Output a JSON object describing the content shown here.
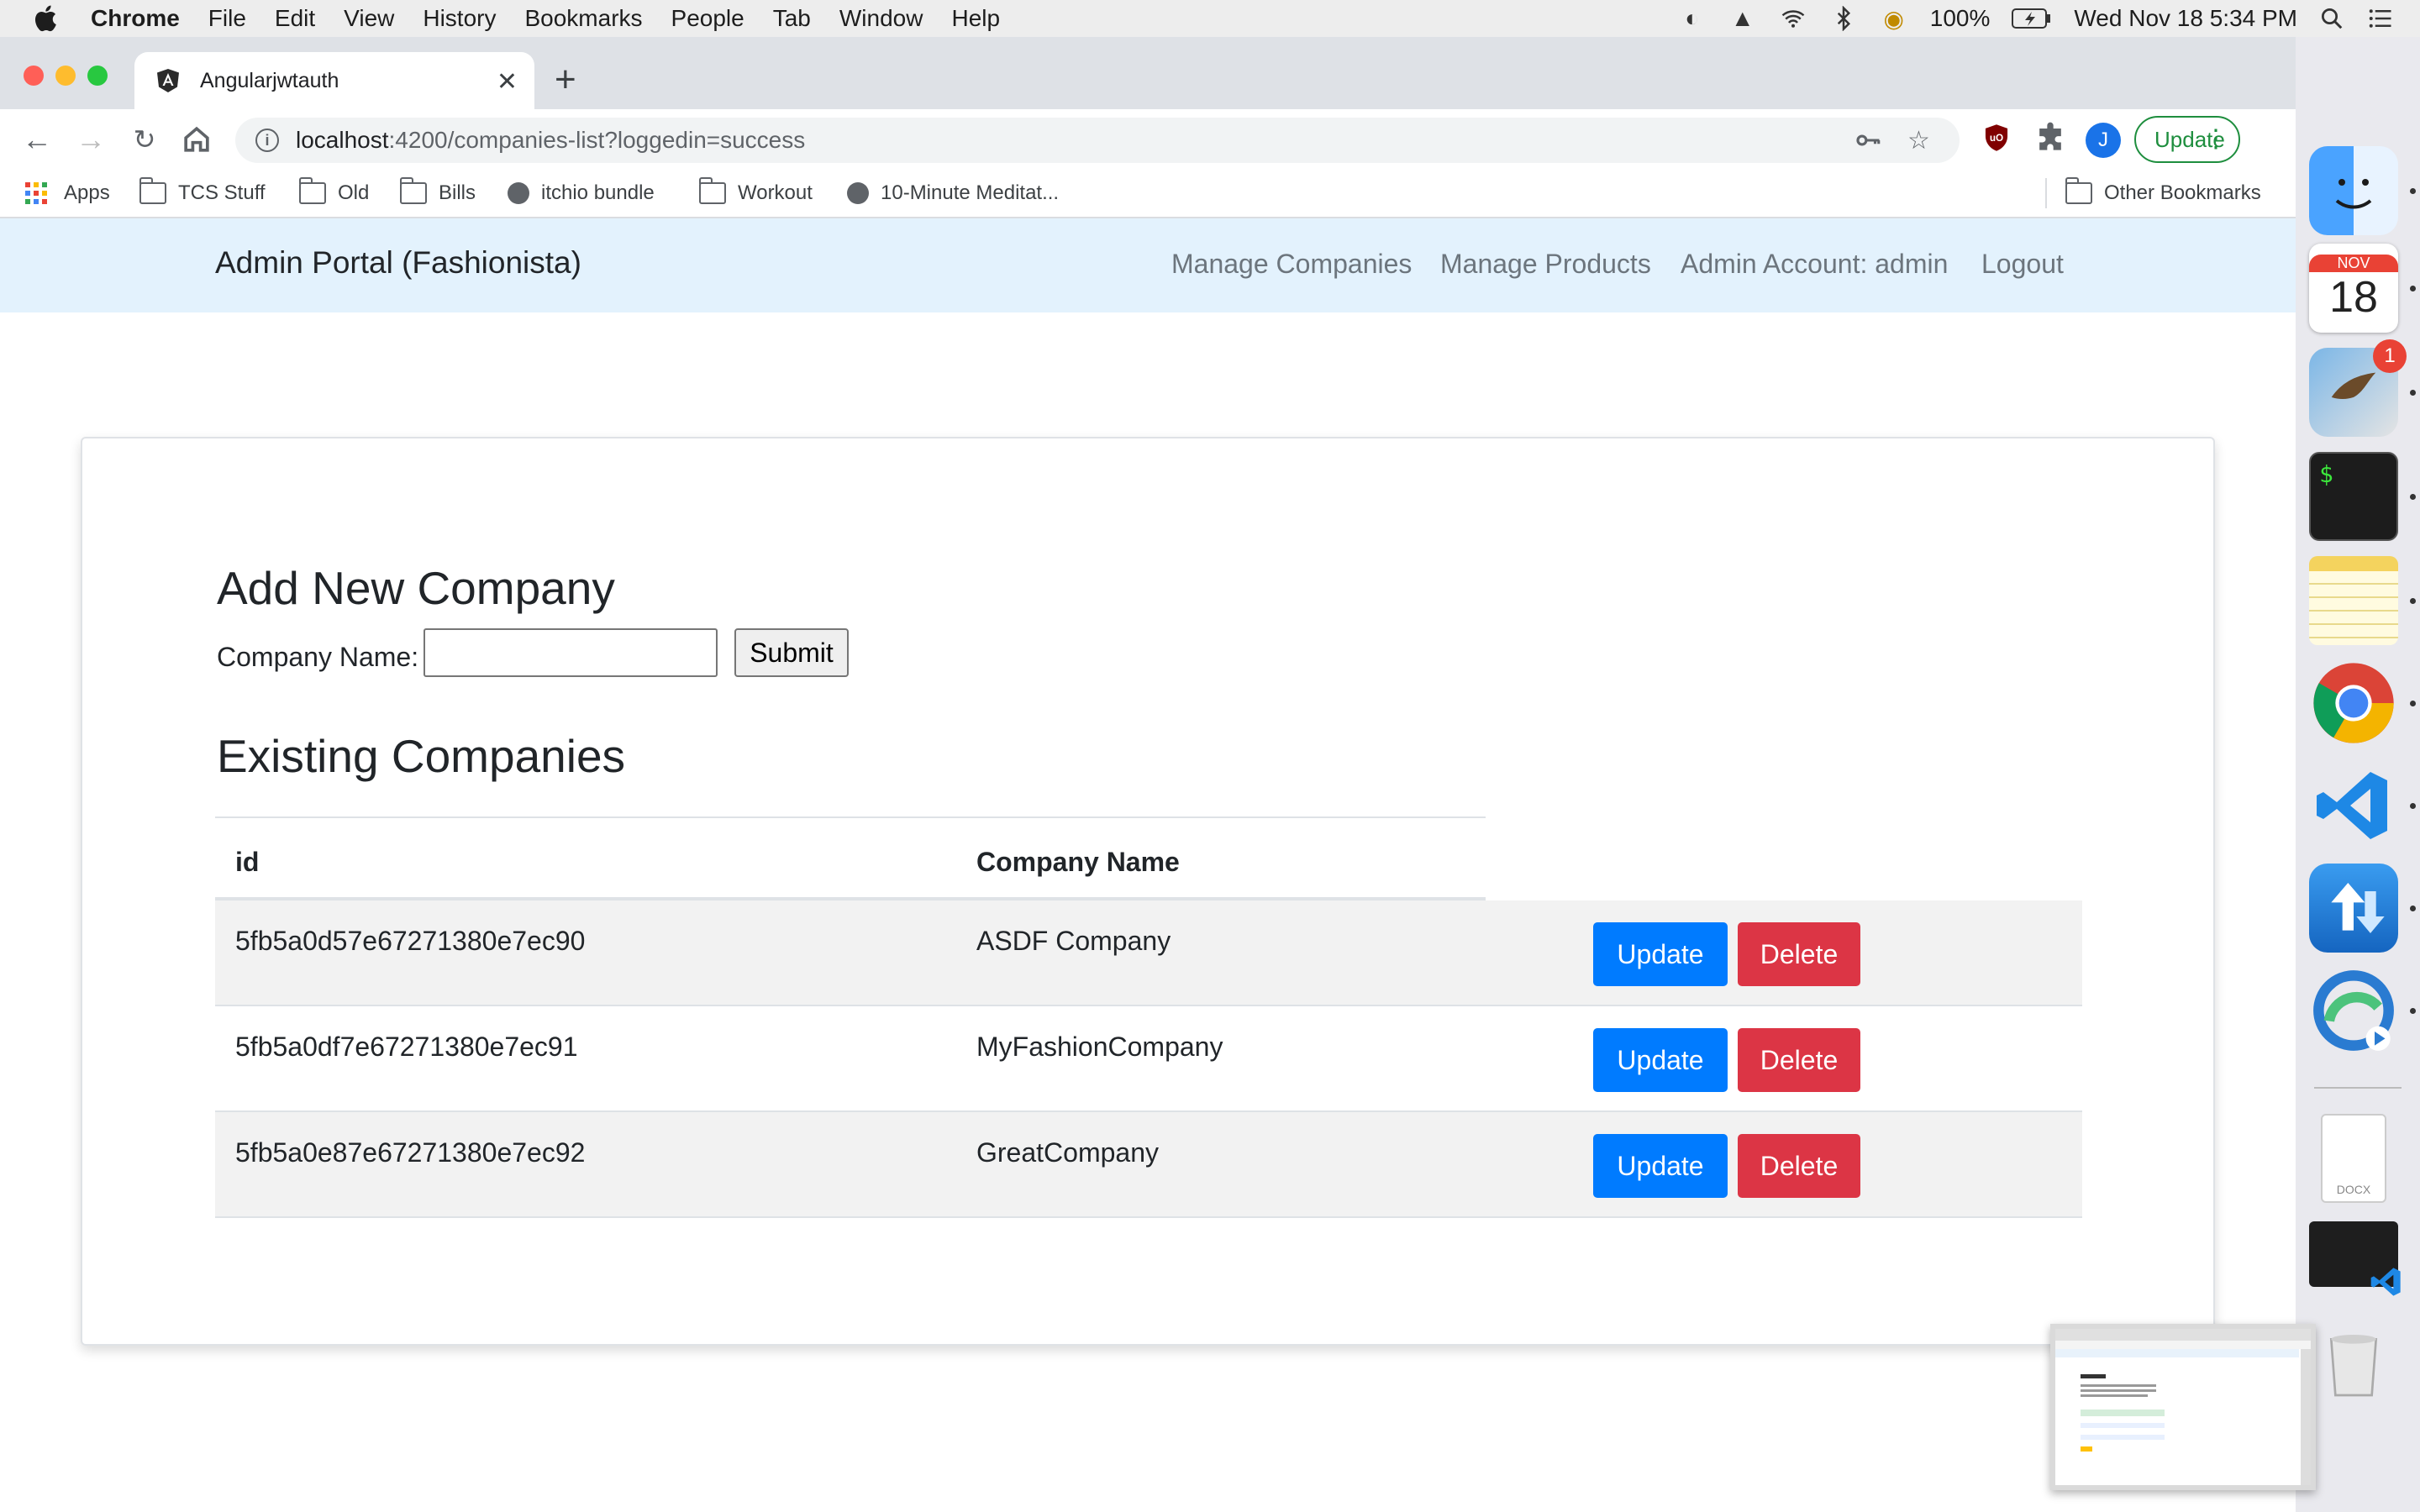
{
  "menubar": {
    "app_name": "Chrome",
    "items": [
      "File",
      "Edit",
      "View",
      "History",
      "Bookmarks",
      "People",
      "Tab",
      "Window",
      "Help"
    ],
    "battery": "100%",
    "datetime": "Wed Nov 18  5:34 PM"
  },
  "browser": {
    "tab_title": "Angularjwtauth",
    "url_host": "localhost",
    "url_path": ":4200/companies-list?loggedin=success",
    "avatar_letter": "J",
    "update_label": "Update",
    "bookmarks": {
      "apps": "Apps",
      "tcs": "TCS Stuff",
      "old": "Old",
      "bills": "Bills",
      "itchio": "itchio bundle",
      "workout": "Workout",
      "meditation": "10-Minute Meditat...",
      "other": "Other Bookmarks"
    }
  },
  "app": {
    "brand": "Admin Portal (Fashionista)",
    "nav": {
      "companies": "Manage Companies",
      "products": "Manage Products",
      "account": "Admin Account: admin",
      "logout": "Logout"
    }
  },
  "form": {
    "heading": "Add New Company",
    "label": "Company Name:",
    "input_value": "",
    "submit": "Submit"
  },
  "companies": {
    "heading": "Existing Companies",
    "headers": {
      "id": "id",
      "name": "Company Name"
    },
    "rows": [
      {
        "id": "5fb5a0d57e67271380e7ec90",
        "name": "ASDF Company",
        "update": "Update",
        "delete": "Delete"
      },
      {
        "id": "5fb5a0df7e67271380e7ec91",
        "name": "MyFashionCompany",
        "update": "Update",
        "delete": "Delete"
      },
      {
        "id": "5fb5a0e87e67271380e7ec92",
        "name": "GreatCompany",
        "update": "Update",
        "delete": "Delete"
      }
    ]
  },
  "dock": {
    "calendar_month": "NOV",
    "calendar_day": "18",
    "mail_badge": "1",
    "docx_label": "DOCX"
  },
  "colors": {
    "navbar_bg": "#e3f2fd",
    "primary": "#007bff",
    "danger": "#dc3545",
    "stripe": "#f2f2f2"
  }
}
